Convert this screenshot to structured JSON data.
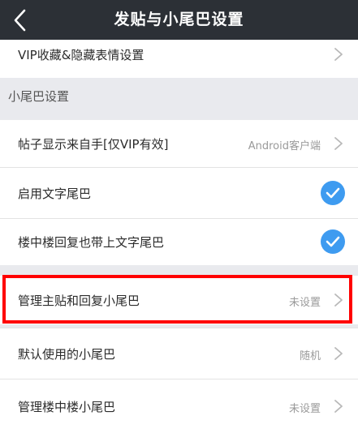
{
  "header": {
    "title": "发贴与小尾巴设置"
  },
  "rows": {
    "vip_collect": {
      "label": "VIP收藏&隐藏表情设置"
    },
    "post_tail": {
      "label": "帖子显示来自手[仅VIP有效]",
      "value": "Android客户端"
    },
    "enable_text_tail": {
      "label": "启用文字尾巴",
      "checked": true
    },
    "floor_reply_text_tail": {
      "label": "楼中楼回复也带上文字尾巴",
      "checked": true
    },
    "manage_tail": {
      "label": "管理主贴和回复小尾巴",
      "value": "未设置"
    },
    "default_tail": {
      "label": "默认使用的小尾巴",
      "value": "随机"
    },
    "manage_floor_tail": {
      "label": "管理楼中楼小尾巴",
      "value": "未设置"
    }
  },
  "sections": {
    "tail_settings": {
      "label": "小尾巴设置"
    }
  },
  "colors": {
    "topbar": "#2c3036",
    "accent_check": "#3e9bf0",
    "highlight_border": "#ff0000",
    "page_bg": "#e9eaee"
  },
  "icons": {
    "back": "chevron-left-icon",
    "row_arrow": "chevron-right-icon",
    "checked": "checkmark-icon"
  }
}
